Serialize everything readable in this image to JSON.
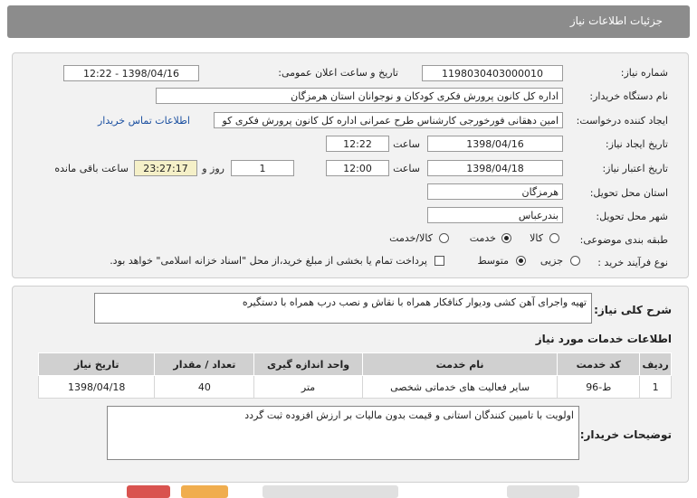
{
  "header": {
    "title": "جزئیات اطلاعات نیاز"
  },
  "form": {
    "need_number_label": "شماره نیاز:",
    "need_number": "1198030403000010",
    "announce_label": "تاریخ و ساعت اعلان عمومی:",
    "announce_value": "1398/04/16 - 12:22",
    "buyer_label": "نام دستگاه خریدار:",
    "buyer_value": "اداره کل کانون پرورش فکری کودکان و نوجوانان استان هرمزگان",
    "creator_label": "ایجاد کننده درخواست:",
    "creator_value": "امین دهقانی فورخورجی کارشناس طرح عمرانی اداره کل کانون پرورش فکری کو",
    "contact_link": "اطلاعات تماس خریدار",
    "created_date_label": "تاریخ ایجاد نیاز:",
    "created_date": "1398/04/16",
    "time_label": "ساعت",
    "created_time": "12:22",
    "valid_date_label": "تاریخ اعتبار نیاز:",
    "valid_date": "1398/04/18",
    "valid_time": "12:00",
    "days_value": "1",
    "days_label": "روز و",
    "remaining_time": "23:27:17",
    "remaining_label": "ساعت باقی مانده",
    "province_label": "استان محل تحویل:",
    "province_value": "هرمزگان",
    "city_label": "شهر محل تحویل:",
    "city_value": "بندرعباس",
    "category_label": "طبقه بندی موضوعی:",
    "category_options": [
      "کالا",
      "خدمت",
      "کالا/خدمت"
    ],
    "category_selected": "خدمت",
    "process_label": "نوع فرآیند خرید :",
    "process_options": [
      "جزیی",
      "متوسط"
    ],
    "process_selected": "متوسط",
    "payment_note": "پرداخت تمام یا بخشی از مبلغ خرید،از محل \"اسناد خزانه اسلامی\" خواهد بود."
  },
  "details": {
    "summary_label": "شرح کلی نیاز:",
    "summary_value": "تهیه واجرای آهن کشی ودیوار کنافکار همراه با نقاش و نصب درب همراه با دستگیره",
    "services_title": "اطلاعات خدمات مورد نیاز",
    "table": {
      "headers": [
        "ردیف",
        "کد خدمت",
        "نام خدمت",
        "واحد اندازه گیری",
        "تعداد / مقدار",
        "تاریخ نیاز"
      ],
      "rows": [
        [
          "1",
          "ط-96",
          "سایر فعالیت های خدماتی شخصی",
          "متر",
          "40",
          "1398/04/18"
        ]
      ]
    },
    "buyer_notes_label": "توضیحات خریدار:",
    "buyer_notes_value": "اولویت با تامیین کنندگان استانی و قیمت بدون مالیات بر ارزش افزوده ثبت گردد"
  },
  "colors": {
    "header_bg": "#8c8c8c",
    "link": "#1a4fa0",
    "remaining_bg": "#f5f0c8"
  }
}
